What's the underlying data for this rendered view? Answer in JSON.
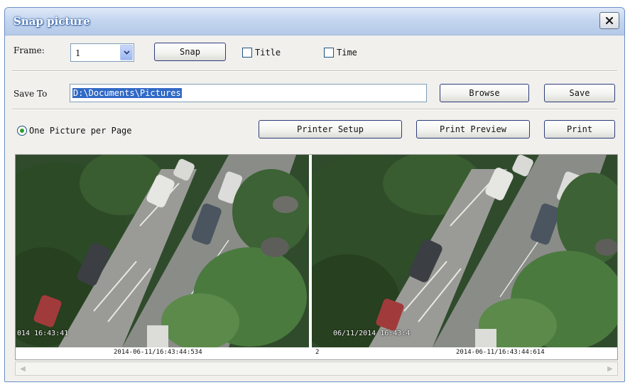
{
  "window": {
    "title": "Snap picture"
  },
  "row1": {
    "frame_label": "Frame:",
    "frame_value": "1",
    "snap_button": "Snap",
    "title_checkbox": "Title",
    "time_checkbox": "Time"
  },
  "row2": {
    "save_to_label": "Save To",
    "save_path": "D:\\Documents\\Pictures",
    "browse_button": "Browse",
    "save_button": "Save"
  },
  "row3": {
    "radio_label": "One Picture per Page",
    "printer_setup_button": "Printer Setup",
    "print_preview_button": "Print Preview",
    "print_button": "Print"
  },
  "preview": {
    "left_overlay": "014 16:43:41",
    "right_overlay": "06/11/2014 16:43:4",
    "left_caption": "2014-06-11/16:43:44:534",
    "center_caption": "2",
    "right_caption": "2014-06-11/16:43:44:614"
  },
  "colors": {
    "titlebar": "#c4d6ef",
    "dialog_bg": "#f1f0ec",
    "selection": "#3169c6"
  }
}
